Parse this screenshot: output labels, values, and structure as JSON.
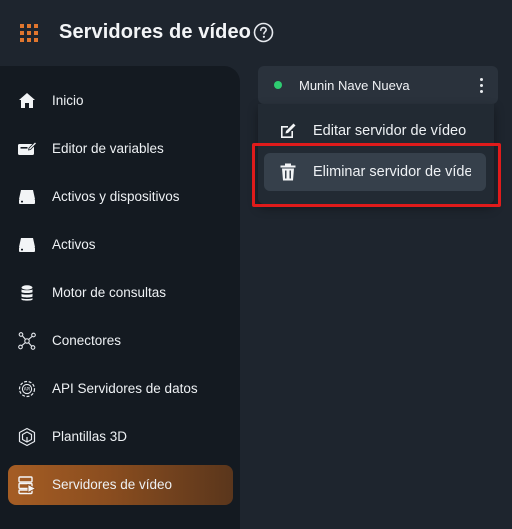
{
  "header": {
    "title": "Servidores de vídeo",
    "menu_icon": "grid-icon",
    "help_icon": "help-circle-icon",
    "accent": "#e0762e"
  },
  "sidebar": {
    "items": [
      {
        "label": "Inicio",
        "icon": "home-icon"
      },
      {
        "label": "Editor de variables",
        "icon": "edit-variables-icon"
      },
      {
        "label": "Activos y dispositivos",
        "icon": "drive-icon"
      },
      {
        "label": "Activos",
        "icon": "drive-icon"
      },
      {
        "label": "Motor de consultas",
        "icon": "database-icon"
      },
      {
        "label": "Conectores",
        "icon": "network-icon"
      },
      {
        "label": "API Servidores de datos",
        "icon": "api-gear-icon"
      },
      {
        "label": "Plantillas 3D",
        "icon": "cube-icon"
      },
      {
        "label": "Servidores de vídeo",
        "icon": "video-server-icon",
        "active": true
      }
    ]
  },
  "server": {
    "name": "Munin Nave Nueva",
    "status_color": "#2ecc71"
  },
  "context_menu": {
    "edit_label": "Editar servidor de vídeo",
    "delete_label": "Eliminar servidor de vídeo"
  },
  "highlight_color": "#e01b1b"
}
